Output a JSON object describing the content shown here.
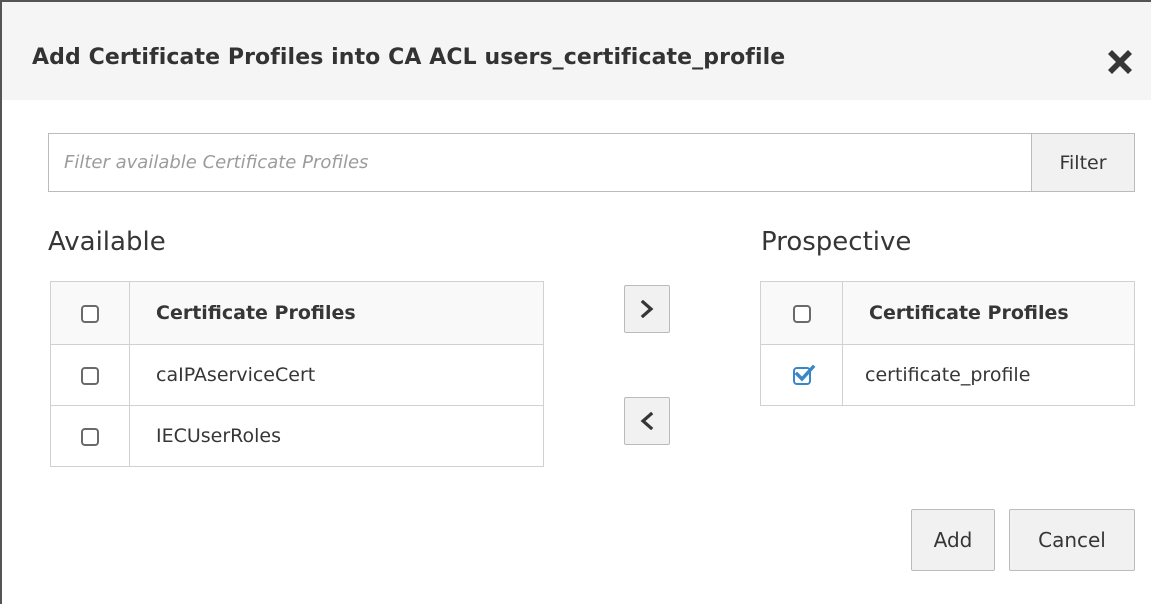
{
  "dialog": {
    "title": "Add Certificate Profiles into CA ACL users_certificate_profile",
    "close_icon": "close-icon"
  },
  "filter": {
    "placeholder": "Filter available Certificate Profiles",
    "value": "",
    "button_label": "Filter"
  },
  "available": {
    "label": "Available",
    "column_header": "Certificate Profiles",
    "rows": [
      {
        "label": "caIPAserviceCert",
        "checked": false
      },
      {
        "label": "IECUserRoles",
        "checked": false
      }
    ]
  },
  "prospective": {
    "label": "Prospective",
    "column_header": "Certificate Profiles",
    "rows": [
      {
        "label": "certificate_profile",
        "checked": true
      }
    ]
  },
  "move_buttons": {
    "add_icon": "chevron-right-icon",
    "remove_icon": "chevron-left-icon"
  },
  "footer": {
    "add_label": "Add",
    "cancel_label": "Cancel"
  },
  "colors": {
    "header_bg": "#f5f5f5",
    "button_bg": "#f1f1f1",
    "border": "#bbbbbb",
    "checkbox_checked": "#3a87c8",
    "text": "#363636"
  }
}
